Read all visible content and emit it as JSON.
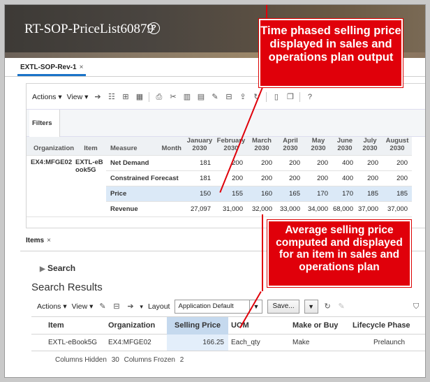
{
  "page": {
    "title": "RT-SOP-PriceList60879",
    "help_glyph": "?"
  },
  "plan_tab": {
    "label": "EXTL-SOP-Rev-1",
    "close": "×"
  },
  "toolbar": {
    "actions": "Actions",
    "view": "View"
  },
  "filters_label": "Filters",
  "pivot": {
    "headers": {
      "organization": "Organization",
      "item": "Item",
      "measure": "Measure",
      "month": "Month"
    },
    "months": [
      {
        "l1": "January",
        "l2": "2030"
      },
      {
        "l1": "February",
        "l2": "2030"
      },
      {
        "l1": "March",
        "l2": "2030"
      },
      {
        "l1": "April",
        "l2": "2030"
      },
      {
        "l1": "May",
        "l2": "2030"
      },
      {
        "l1": "June",
        "l2": "2030"
      },
      {
        "l1": "July",
        "l2": "2030"
      },
      {
        "l1": "August",
        "l2": "2030"
      }
    ],
    "organization": "EX4:MFGE02",
    "item": "EXTL-eBook5G",
    "rows": [
      {
        "measure": "Net Demand",
        "values": [
          "181",
          "200",
          "200",
          "200",
          "200",
          "400",
          "200",
          "200"
        ]
      },
      {
        "measure": "Constrained Forecast",
        "values": [
          "181",
          "200",
          "200",
          "200",
          "200",
          "400",
          "200",
          "200"
        ]
      },
      {
        "measure": "Price",
        "values": [
          "150",
          "155",
          "160",
          "165",
          "170",
          "170",
          "185",
          "185"
        ]
      },
      {
        "measure": "Revenue",
        "values": [
          "27,097",
          "31,000",
          "32,000",
          "33,000",
          "34,000",
          "68,000",
          "37,000",
          "37,000"
        ]
      }
    ]
  },
  "callouts": {
    "top": "Time phased selling price displayed in sales and operations plan output",
    "bottom": "Average selling price computed and displayed for an item in sales and operations plan"
  },
  "items_tab": {
    "label": "Items",
    "close": "×"
  },
  "search": {
    "toggle": "Search",
    "results_title": "Search Results",
    "toolbar": {
      "actions": "Actions",
      "view": "View",
      "layout_label": "Layout",
      "layout_value": "Application Default",
      "save": "Save..."
    },
    "columns": {
      "item": "Item",
      "organization": "Organization",
      "selling_price": "Selling Price",
      "uom": "UOM",
      "make_or_buy": "Make or Buy",
      "lifecycle_phase": "Lifecycle Phase"
    },
    "row": {
      "item": "EXTL-eBook5G",
      "organization": "EX4:MFGE02",
      "selling_price": "166.25",
      "uom": "Each_qty",
      "make_or_buy": "Make",
      "lifecycle_phase": "Prelaunch"
    },
    "footer": {
      "hidden_label": "Columns Hidden",
      "hidden_value": "30",
      "frozen_label": "Columns Frozen",
      "frozen_value": "2"
    }
  },
  "colors": {
    "callout_red": "#e0000a",
    "accent_blue": "#1a73c8",
    "selected_col": "#c5d9ee",
    "highlight_row": "#dbe9f7"
  }
}
